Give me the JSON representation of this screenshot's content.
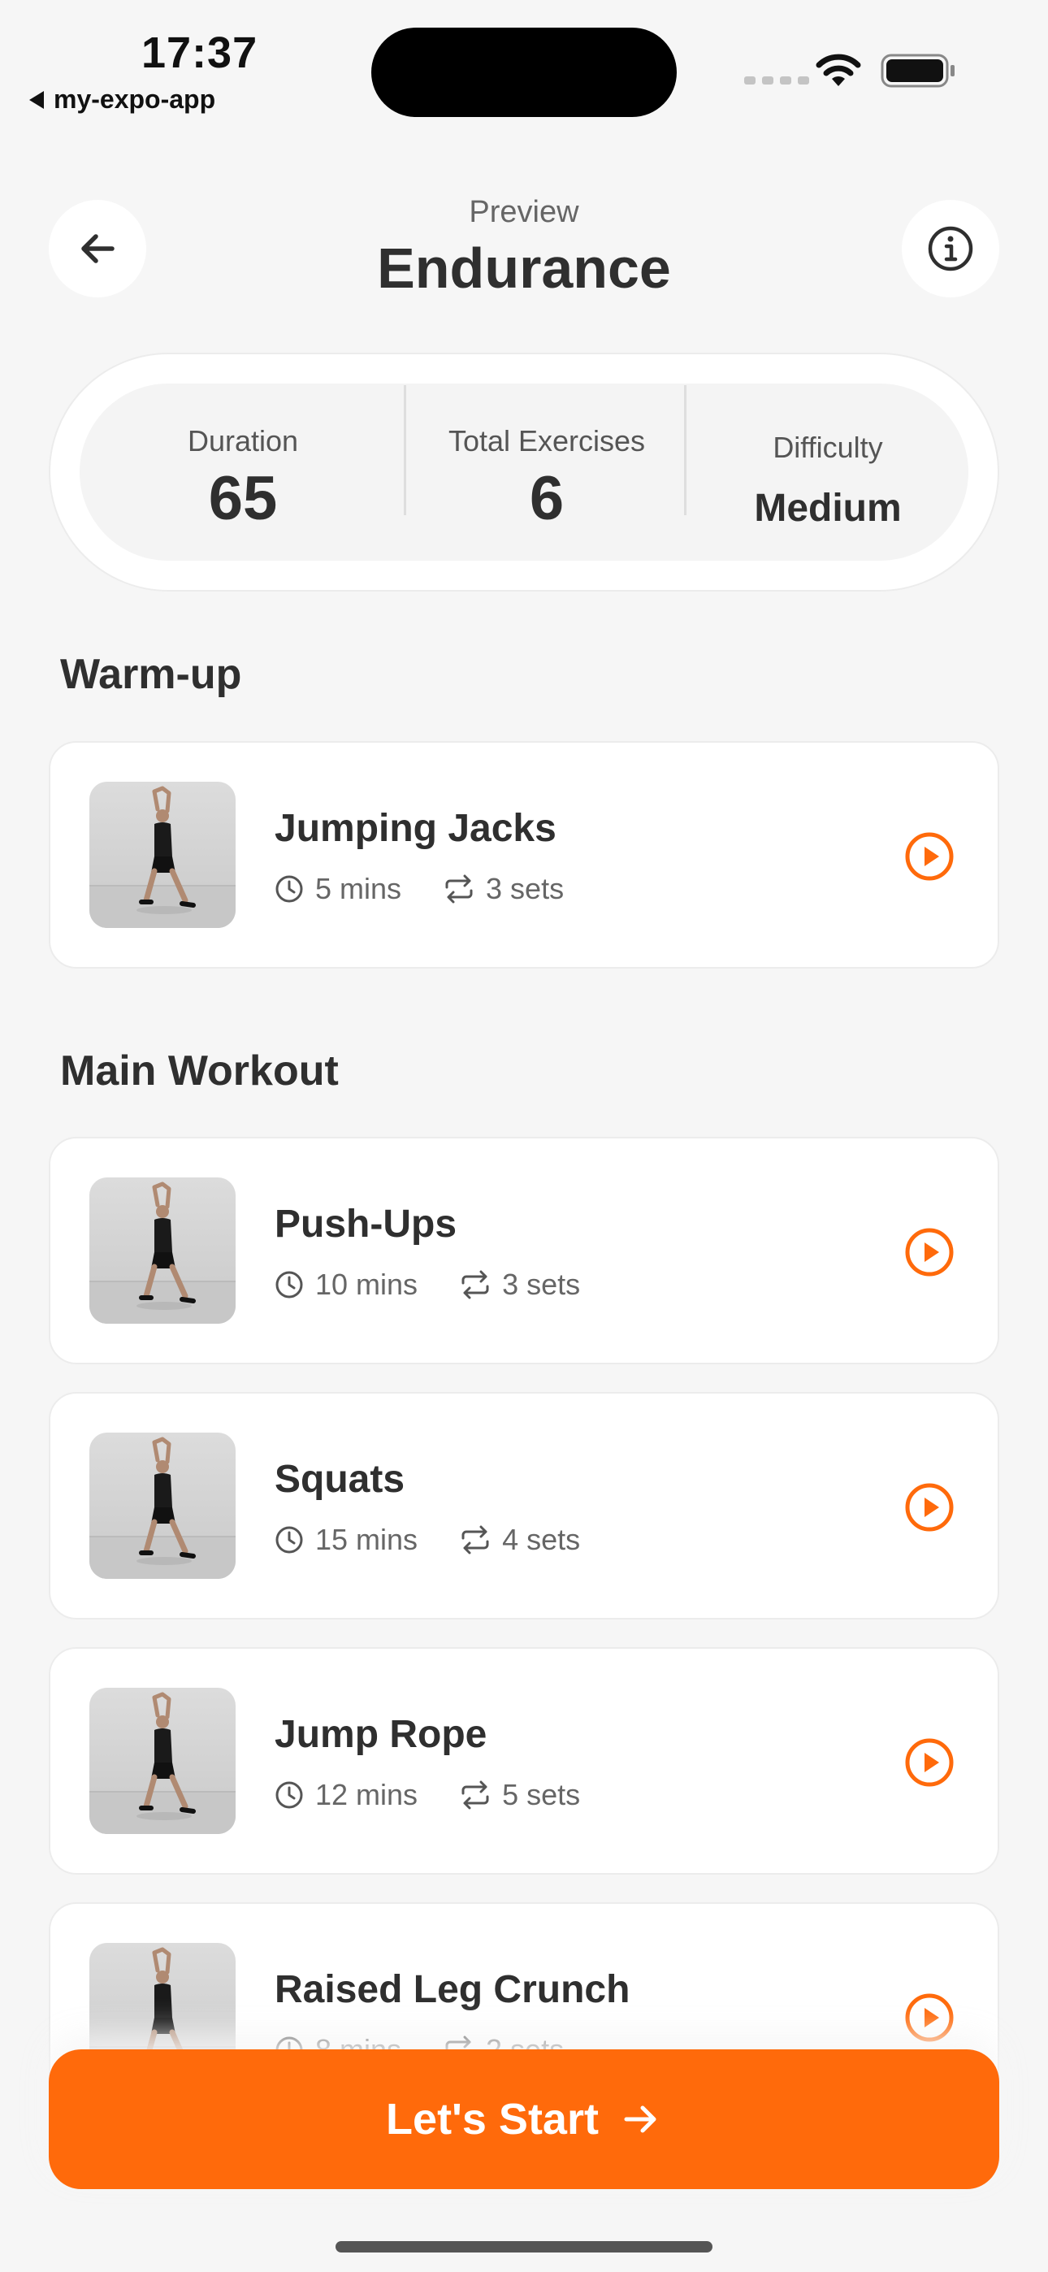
{
  "status_bar": {
    "time": "17:37",
    "back_app": "my-expo-app"
  },
  "header": {
    "subtitle": "Preview",
    "title": "Endurance",
    "back_icon": "arrow-left-icon",
    "info_icon": "info-icon"
  },
  "stats": {
    "duration_label": "Duration",
    "duration_value": "65",
    "exercises_label": "Total Exercises",
    "exercises_value": "6",
    "difficulty_label": "Difficulty",
    "difficulty_value": "Medium"
  },
  "sections": {
    "warmup_title": "Warm-up",
    "main_title": "Main Workout"
  },
  "exercises": [
    {
      "name": "Jumping Jacks",
      "duration": "5 mins",
      "sets": "3 sets"
    },
    {
      "name": "Push-Ups",
      "duration": "10 mins",
      "sets": "3 sets"
    },
    {
      "name": "Squats",
      "duration": "15 mins",
      "sets": "4 sets"
    },
    {
      "name": "Jump Rope",
      "duration": "12 mins",
      "sets": "5 sets"
    },
    {
      "name": "Raised Leg Crunch",
      "duration": "8 mins",
      "sets": "2 sets"
    }
  ],
  "cta": {
    "label": "Let's Start",
    "icon": "arrow-right-icon"
  },
  "colors": {
    "accent": "#ff6a0b",
    "background": "#f6f6f6",
    "card": "#ffffff",
    "text": "#2f2f2f"
  }
}
